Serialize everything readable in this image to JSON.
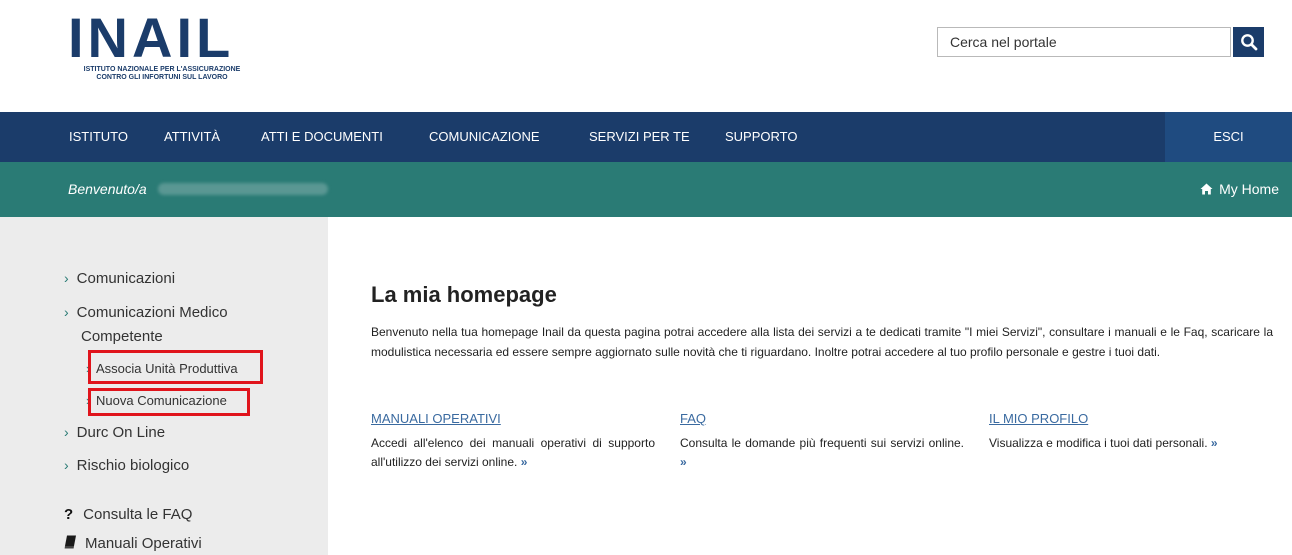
{
  "header": {
    "logo_text": "INAIL",
    "logo_sub_line1": "ISTITUTO NAZIONALE PER L'ASSICURAZIONE",
    "logo_sub_line2": "CONTRO GLI INFORTUNI SUL LAVORO",
    "search_placeholder": "Cerca nel portale",
    "search_icon": "search-icon"
  },
  "nav": {
    "items": [
      "ISTITUTO",
      "ATTIVITÀ",
      "ATTI E DOCUMENTI",
      "COMUNICAZIONE",
      "SERVIZI PER TE",
      "SUPPORTO"
    ],
    "logout_label": "ESCI"
  },
  "welcome": {
    "greeting": "Benvenuto/a",
    "home_label": "My Home",
    "home_icon": "home-icon"
  },
  "sidebar": {
    "items": [
      {
        "label": "Comunicazioni"
      },
      {
        "label": "Comunicazioni Medico"
      },
      {
        "label": "Competente"
      },
      {
        "label": "Associa Unità Produttiva"
      },
      {
        "label": "Nuova Comunicazione"
      },
      {
        "label": "Durc On Line"
      },
      {
        "label": "Rischio biologico"
      }
    ],
    "faq_label": "Consulta le FAQ",
    "manuals_label": "Manuali Operativi",
    "faq_icon": "question-icon",
    "manuals_icon": "book-icon"
  },
  "main": {
    "title": "La mia homepage",
    "intro": "Benvenuto nella tua homepage Inail da questa pagina potrai accedere alla lista dei servizi a te dedicati tramite \"I miei Servizi\", consultare i manuali e le Faq, scaricare la modulistica necessaria ed essere sempre aggiornato sulle novità che ti riguardano. Inoltre potrai accedere al tuo profilo personale e gestre i tuoi dati.",
    "cards": [
      {
        "title": "MANUALI OPERATIVI",
        "desc": "Accedi all'elenco dei manuali operativi di supporto all'utilizzo dei servizi online."
      },
      {
        "title": "FAQ",
        "desc": "Consulta le domande più frequenti sui servizi online."
      },
      {
        "title": "IL MIO PROFILO",
        "desc": "Visualizza e modifica i tuoi dati personali."
      }
    ],
    "more_glyph": "»"
  },
  "colors": {
    "nav_bg": "#1b3c6a",
    "welcome_bg": "#2a7b75",
    "highlight": "#e0141c",
    "link": "#3a6aa0"
  }
}
